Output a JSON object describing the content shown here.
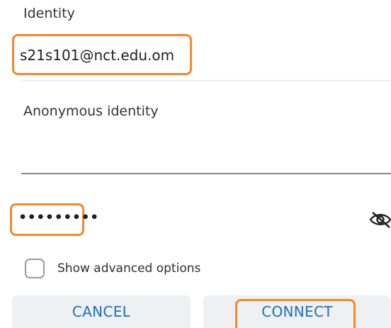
{
  "identity": {
    "label": "Identity",
    "value": "s21s101@nct.edu.om"
  },
  "anonymous_identity": {
    "label": "Anonymous identity",
    "value": ""
  },
  "password": {
    "value": "•••••••••"
  },
  "advanced": {
    "label": "Show advanced options",
    "checked": false
  },
  "buttons": {
    "cancel": "CANCEL",
    "connect": "CONNECT"
  },
  "colors": {
    "highlight": "#f08a2c",
    "button_text": "#1e6fbf",
    "button_bg": "#eef0f2"
  }
}
